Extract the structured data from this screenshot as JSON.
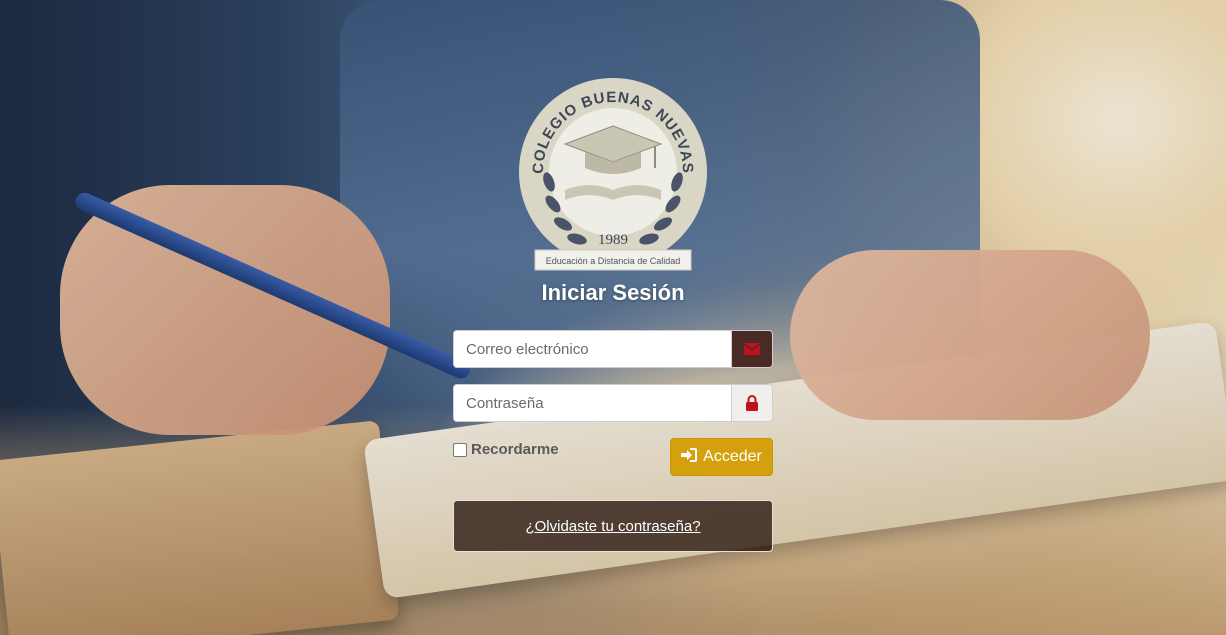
{
  "logo": {
    "arc_text": "COLEGIO BUENAS NUEVAS",
    "year": "1989",
    "ribbon_text": "Educación a Distancia de Calidad"
  },
  "login": {
    "title": "Iniciar Sesión",
    "email_placeholder": "Correo electrónico",
    "password_placeholder": "Contraseña",
    "remember_label": "Recordarme",
    "remember_checked": false,
    "submit_label": "Acceder",
    "forgot_link": "¿Olvidaste tu contraseña?"
  },
  "icons": {
    "email": "envelope-icon",
    "password": "lock-icon",
    "submit": "sign-in-icon"
  },
  "colors": {
    "accent": "#d4a00e",
    "icon_red": "#c0111d",
    "email_addon_bg": "#4a2a24"
  }
}
